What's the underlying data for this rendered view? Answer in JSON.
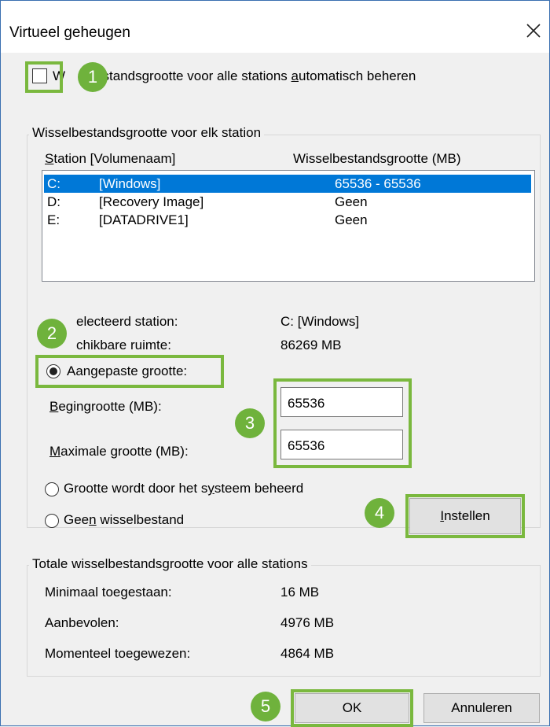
{
  "dialog": {
    "title": "Virtueel geheugen",
    "close_icon": "close-icon"
  },
  "auto_manage": {
    "checked": false,
    "label_visible_start": "W",
    "label_visible_rest": "estandsgrootte voor alle stations ",
    "label_access": "a",
    "label_end": "utomatisch beheren"
  },
  "per_drive": {
    "group_label": "Wisselbestandsgrootte voor elk station",
    "col_station_access": "S",
    "col_station_rest": "tation [Volumenaam]",
    "col_size": "Wisselbestandsgrootte (MB)",
    "drives": [
      {
        "letter": "C:",
        "name": "[Windows]",
        "size": "65536 - 65536",
        "selected": true
      },
      {
        "letter": "D:",
        "name": "[Recovery Image]",
        "size": "Geen",
        "selected": false
      },
      {
        "letter": "E:",
        "name": "[DATADRIVE1]",
        "size": "Geen",
        "selected": false
      }
    ],
    "selected_label_visible": "electeerd station:",
    "selected_value": "C:  [Windows]",
    "free_label_visible": "chikbare ruimte:",
    "free_value": "86269 MB",
    "custom_size_label_start": "Aangepaste ",
    "custom_size_access": "g",
    "custom_size_label_end": "rootte:",
    "initial_label_access": "B",
    "initial_label_rest": "egingrootte (MB):",
    "initial_value": "65536",
    "max_label_access": "M",
    "max_label_rest": "aximale grootte (MB):",
    "max_value": "65536",
    "system_managed_start": "Grootte wordt door het s",
    "system_managed_access": "y",
    "system_managed_end": "steem beheerd",
    "no_paging_start": "Gee",
    "no_paging_access": "n",
    "no_paging_end": " wisselbestand",
    "set_button_access": "I",
    "set_button_rest": "nstellen"
  },
  "totals": {
    "group_label": "Totale wisselbestandsgrootte voor alle stations",
    "min_label": "Minimaal toegestaan:",
    "min_value": "16 MB",
    "recommended_label": "Aanbevolen:",
    "recommended_value": "4976 MB",
    "current_label": "Momenteel toegewezen:",
    "current_value": "4864 MB"
  },
  "buttons": {
    "ok": "OK",
    "cancel": "Annuleren"
  },
  "annotations": {
    "accent_color": "#7ab83e",
    "badges": [
      "1",
      "2",
      "3",
      "4",
      "5"
    ]
  }
}
